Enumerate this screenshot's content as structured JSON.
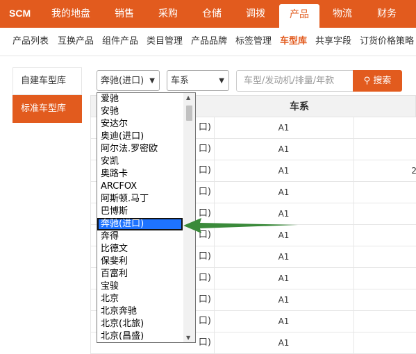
{
  "topnav": {
    "logo": "SCM",
    "items": [
      "我的地盘",
      "销售",
      "采购",
      "仓储",
      "调拨",
      "产品",
      "物流",
      "财务"
    ],
    "active": "产品"
  },
  "subnav": {
    "items": [
      "产品列表",
      "互换产品",
      "组件产品",
      "类目管理",
      "产品品牌",
      "标签管理",
      "车型库",
      "共享字段",
      "订货价格策略"
    ],
    "active": "车型库"
  },
  "left_panel": {
    "items": [
      "自建车型库",
      "标准车型库"
    ],
    "active": "标准车型库"
  },
  "filters": {
    "brand_select": "奔驰(进口)",
    "series_select": "车系",
    "search_placeholder": "车型/发动机/排量/年款",
    "search_button": "搜索"
  },
  "table": {
    "col2_header": "车系",
    "rows": [
      {
        "c1": "口)",
        "c2": "A1",
        "c3": ""
      },
      {
        "c1": "口)",
        "c2": "A1",
        "c3": ""
      },
      {
        "c1": "口)",
        "c2": "A1",
        "c3": "2"
      },
      {
        "c1": "口)",
        "c2": "A1",
        "c3": ""
      },
      {
        "c1": "口)",
        "c2": "A1",
        "c3": ""
      },
      {
        "c1": "口)",
        "c2": "A1",
        "c3": ""
      },
      {
        "c1": "口)",
        "c2": "A1",
        "c3": ""
      },
      {
        "c1": "口)",
        "c2": "A1",
        "c3": ""
      },
      {
        "c1": "口)",
        "c2": "A1",
        "c3": ""
      },
      {
        "c1": "口)",
        "c2": "A1",
        "c3": ""
      },
      {
        "c1": "口)",
        "c2": "A1",
        "c3": ""
      }
    ]
  },
  "dropdown": {
    "options": [
      "爱驰",
      "安驰",
      "安达尔",
      "奥迪(进口)",
      "阿尔法.罗密欧",
      "安凯",
      "奥路卡",
      "ARCFOX",
      "阿斯顿.马丁",
      "巴博斯",
      "奔驰(进口)",
      "奔得",
      "比德文",
      "保斐利",
      "百富利",
      "宝骏",
      "北京",
      "北京奔驰",
      "北京(北旅)",
      "北京(昌盛)"
    ],
    "selected": "奔驰(进口)"
  },
  "colors": {
    "accent": "#e25b1e",
    "selection": "#1e73ff",
    "arrow": "#3a8a3a"
  }
}
